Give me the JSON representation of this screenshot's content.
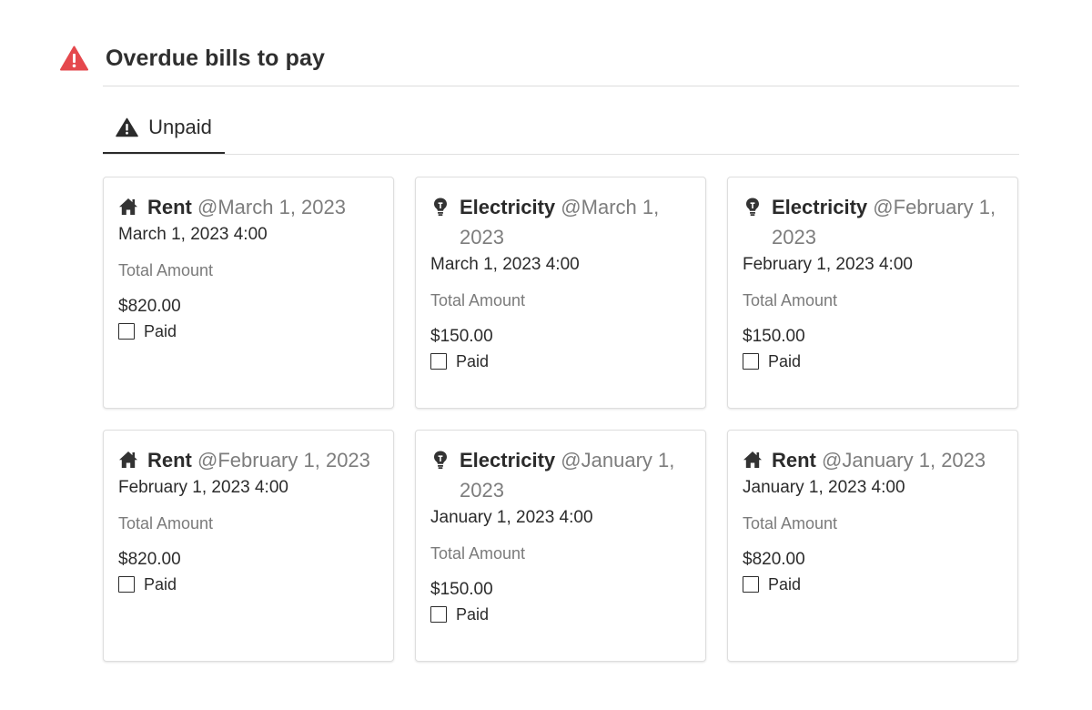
{
  "header": {
    "title": "Overdue bills to pay",
    "icon": "warning-triangle-icon",
    "icon_color": "#e5484d"
  },
  "tabs": [
    {
      "label": "Unpaid",
      "icon": "warning-triangle-icon",
      "active": true
    }
  ],
  "cards": [
    {
      "icon": "house-icon",
      "name": "Rent",
      "mention": "@March 1, 2023",
      "datetime": "March 1, 2023 4:00",
      "amount_label": "Total Amount",
      "amount": "$820.00",
      "paid_label": "Paid",
      "paid": false
    },
    {
      "icon": "lightbulb-icon",
      "name": "Electricity",
      "mention": "@March 1, 2023",
      "datetime": "March 1, 2023 4:00",
      "amount_label": "Total Amount",
      "amount": "$150.00",
      "paid_label": "Paid",
      "paid": false
    },
    {
      "icon": "lightbulb-icon",
      "name": "Electricity",
      "mention": "@February 1, 2023",
      "datetime": "February 1, 2023 4:00",
      "amount_label": "Total Amount",
      "amount": "$150.00",
      "paid_label": "Paid",
      "paid": false
    },
    {
      "icon": "house-icon",
      "name": "Rent",
      "mention": "@February 1, 2023",
      "datetime": "February 1, 2023 4:00",
      "amount_label": "Total Amount",
      "amount": "$820.00",
      "paid_label": "Paid",
      "paid": false
    },
    {
      "icon": "lightbulb-icon",
      "name": "Electricity",
      "mention": "@January 1, 2023",
      "datetime": "January 1, 2023 4:00",
      "amount_label": "Total Amount",
      "amount": "$150.00",
      "paid_label": "Paid",
      "paid": false
    },
    {
      "icon": "house-icon",
      "name": "Rent",
      "mention": "@January 1, 2023",
      "datetime": "January 1, 2023 4:00",
      "amount_label": "Total Amount",
      "amount": "$820.00",
      "paid_label": "Paid",
      "paid": false
    }
  ]
}
